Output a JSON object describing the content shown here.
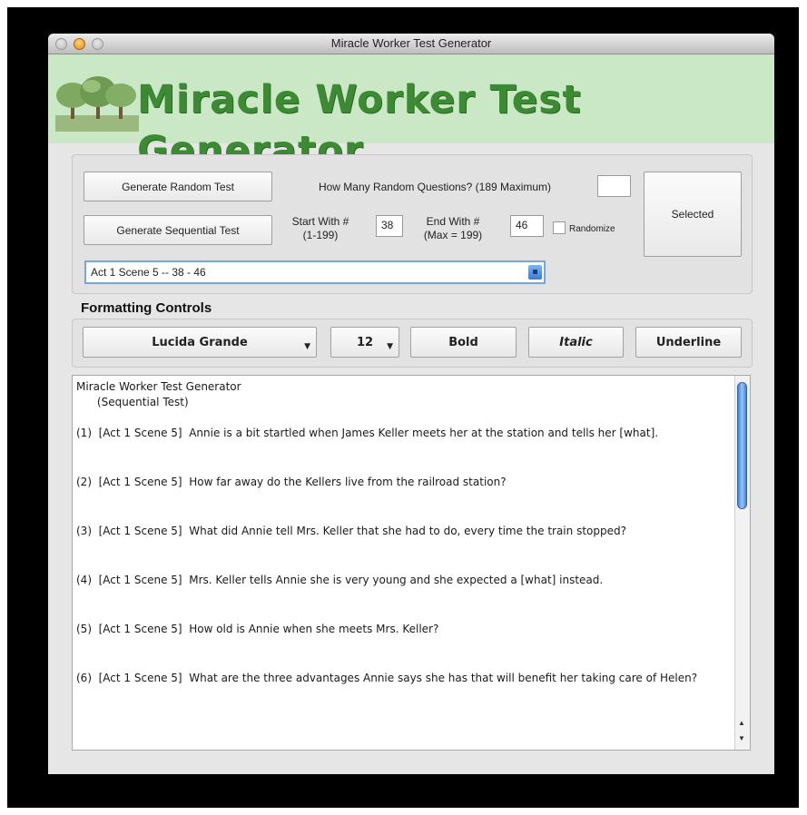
{
  "window": {
    "title": "Miracle Worker Test Generator"
  },
  "banner": {
    "title": "Miracle Worker Test Generator",
    "logo": "trees-logo"
  },
  "controls": {
    "generate_random_label": "Generate Random Test",
    "generate_sequential_label": "Generate Sequential Test",
    "random_count_label": "How Many Random Questions? (189 Maximum)",
    "random_count_value": "",
    "start_label_line1": "Start With #",
    "start_label_line2": "(1-199)",
    "start_value": "38",
    "end_label_line1": "End With #",
    "end_label_line2": "(Max = 199)",
    "end_value": "46",
    "randomize_label": "Randomize",
    "randomize_checked": false,
    "selected_label": "Selected",
    "range_select_value": "Act 1 Scene 5  --  38 - 46"
  },
  "formatting": {
    "section_title": "Formatting Controls",
    "font_name": "Lucida Grande",
    "font_size": "12",
    "bold_label": "Bold",
    "italic_label": "Italic",
    "underline_label": "Underline"
  },
  "document": {
    "title": "Miracle Worker Test Generator",
    "subtitle": "      (Sequential Test)",
    "questions": [
      "(1)  [Act 1 Scene 5]  Annie is a bit startled when James Keller meets her at the station and tells her [what].",
      "(2)  [Act 1 Scene 5]  How far away do the Kellers live from the railroad station?",
      "(3)  [Act 1 Scene 5]  What did Annie tell Mrs. Keller that she had to do, every time the train stopped?",
      "(4)  [Act 1 Scene 5]  Mrs. Keller tells Annie she is very young and she expected a [what] instead.",
      "(5)  [Act 1 Scene 5]  How old is Annie when she meets Mrs. Keller?",
      "(6)  [Act 1 Scene 5]  What are the three advantages Annie says she has that will benefit her taking care of Helen?"
    ]
  },
  "colors": {
    "banner_bg": "#cbe8c6",
    "banner_text": "#3c8a33",
    "select_border": "#7aa6e0",
    "scroll_thumb": "#3f82dc"
  }
}
